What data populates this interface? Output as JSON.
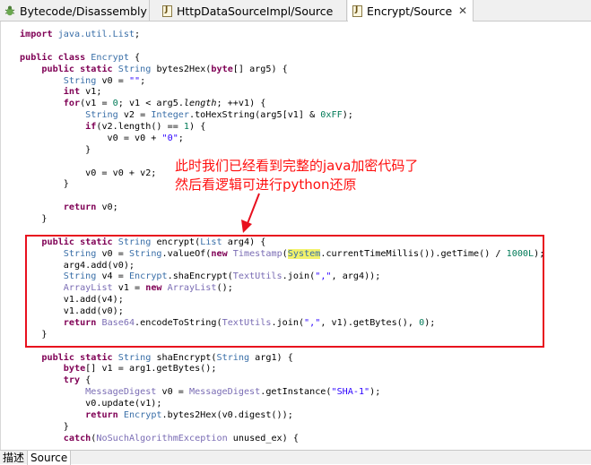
{
  "tabs": [
    {
      "label": "Bytecode/Disassembly",
      "icon": "bug-icon"
    },
    {
      "label": "HttpDataSourceImpl/Source",
      "icon": "java-file-icon"
    },
    {
      "label": "Encrypt/Source",
      "icon": "java-file-icon",
      "active": true,
      "close": "✕"
    }
  ],
  "annotation": {
    "line1": "此时我们已经看到完整的java加密代码了",
    "line2": "然后看逻辑可进行python还原",
    "color": "#ff1010"
  },
  "code": [
    "import java.util.List;",
    "",
    "public class Encrypt {",
    "    public static String bytes2Hex(byte[] arg5) {",
    "        String v0 = \"\";",
    "        int v1;",
    "        for(v1 = 0; v1 < arg5.length; ++v1) {",
    "            String v2 = Integer.toHexString(arg5[v1] & 0xFF);",
    "            if(v2.length() == 1) {",
    "                v0 = v0 + \"0\";",
    "            }",
    "",
    "            v0 = v0 + v2;",
    "        }",
    "",
    "        return v0;",
    "    }",
    "",
    "    public static String encrypt(List arg4) {",
    "        String v0 = String.valueOf(new Timestamp(System.currentTimeMillis()).getTime() / 1000L);",
    "        arg4.add(v0);",
    "        String v4 = Encrypt.shaEncrypt(TextUtils.join(\",\", arg4));",
    "        ArrayList v1 = new ArrayList();",
    "        v1.add(v4);",
    "        v1.add(v0);",
    "        return Base64.encodeToString(TextUtils.join(\",\", v1).getBytes(), 0);",
    "    }",
    "",
    "    public static String shaEncrypt(String arg1) {",
    "        byte[] v1 = arg1.getBytes();",
    "        try {",
    "            MessageDigest v0 = MessageDigest.getInstance(\"SHA-1\");",
    "            v0.update(v1);",
    "            return Encrypt.bytes2Hex(v0.digest());",
    "        }",
    "        catch(NoSuchAlgorithmException unused_ex) {"
  ],
  "bottom_tabs": [
    {
      "label": "描述"
    },
    {
      "label": "Source",
      "active": true
    }
  ],
  "colors": {
    "keyword": "#7f0055",
    "type": "#3a6fa8",
    "string": "#2a00ff",
    "number": "#007a57",
    "highlight_box": "#e8101e"
  }
}
